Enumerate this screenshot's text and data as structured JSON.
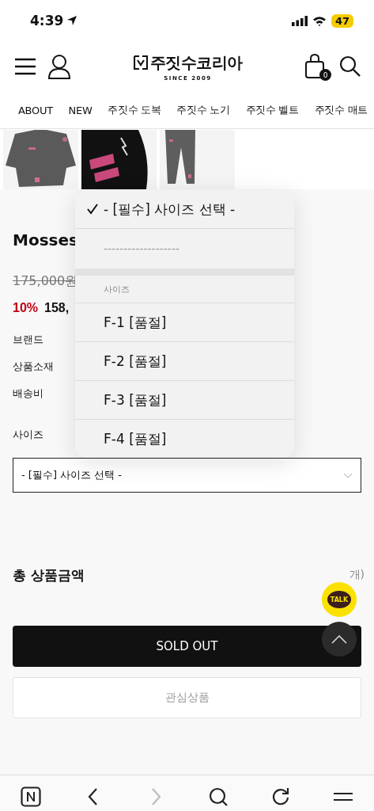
{
  "status_bar": {
    "time": "4:39",
    "battery": "47"
  },
  "header": {
    "logo": "주짓수코리아",
    "tagline": "SINCE 2009",
    "cart_count": "0"
  },
  "nav": [
    {
      "label": "ABOUT"
    },
    {
      "label": "NEW"
    },
    {
      "label": "주짓수 도복"
    },
    {
      "label": "주짓수 노기"
    },
    {
      "label": "주짓수 벨트"
    },
    {
      "label": "주짓수 매트"
    }
  ],
  "product": {
    "name": "Mosses",
    "original_price": "175,000원",
    "discount": "10%",
    "price": "158,",
    "specs": [
      "브랜드",
      "상품소재",
      "배송비"
    ],
    "option_label": "사이즈",
    "select_value": "- [필수] 사이즈 선택 -"
  },
  "total": {
    "label": "총 상품금액",
    "count": "개)"
  },
  "buttons": {
    "sold_out": "SOLD OUT",
    "wishlist": "관심상품"
  },
  "talk": "TALK",
  "picker": {
    "items": [
      {
        "kind": "option",
        "label": "- [필수] 사이즈 선택 -",
        "selected": true,
        "disabled": false
      },
      {
        "kind": "option",
        "label": "-------------------",
        "selected": false,
        "disabled": true
      },
      {
        "kind": "separator"
      },
      {
        "kind": "group",
        "label": "사이즈"
      },
      {
        "kind": "option",
        "label": "F-1 [품절]",
        "selected": false,
        "disabled": false
      },
      {
        "kind": "option",
        "label": "F-2 [품절]",
        "selected": false,
        "disabled": false
      },
      {
        "kind": "option",
        "label": "F-3 [품절]",
        "selected": false,
        "disabled": false
      },
      {
        "kind": "option",
        "label": "F-4 [품절]",
        "selected": false,
        "disabled": false
      }
    ]
  }
}
